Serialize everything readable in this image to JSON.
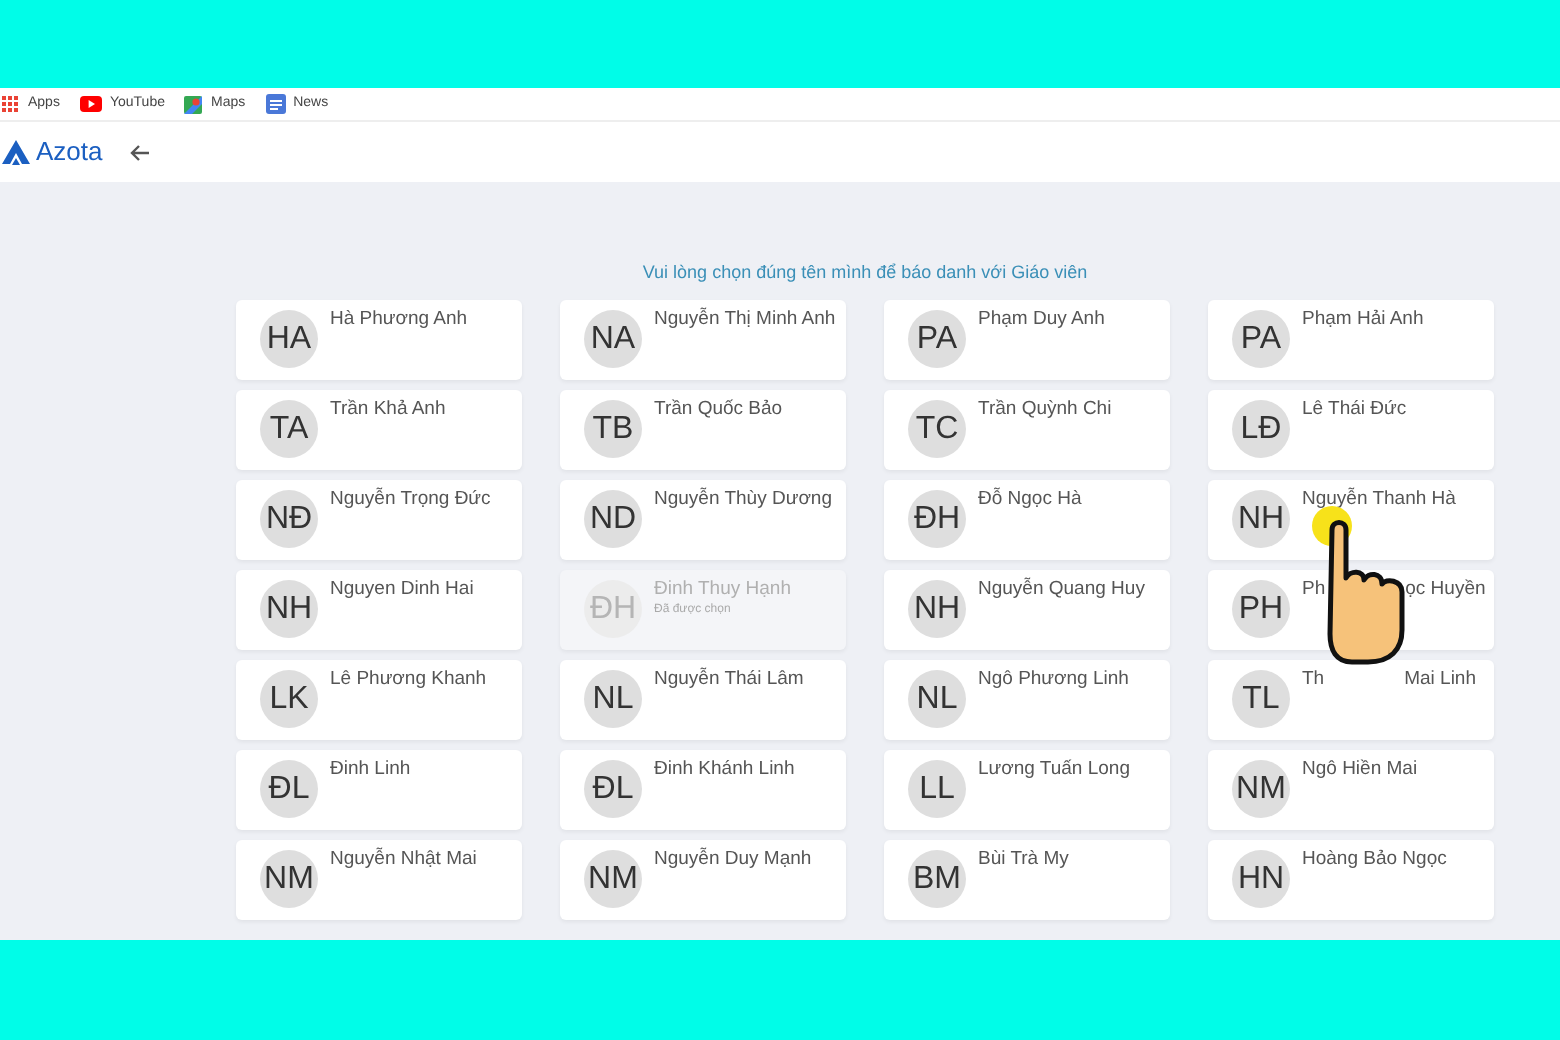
{
  "bookmarks": [
    {
      "kind": "apps",
      "label": "Apps"
    },
    {
      "kind": "youtube",
      "label": "YouTube"
    },
    {
      "kind": "maps",
      "label": "Maps"
    },
    {
      "kind": "news",
      "label": "News"
    }
  ],
  "brand": "Azota",
  "prompt": "Vui lòng chọn đúng tên mình để báo danh với Giáo viên",
  "students": [
    {
      "initials": "HA",
      "name": "Hà Phương Anh",
      "taken": false
    },
    {
      "initials": "NA",
      "name": "Nguyễn Thị Minh Anh",
      "taken": false
    },
    {
      "initials": "PA",
      "name": "Phạm Duy Anh",
      "taken": false
    },
    {
      "initials": "PA",
      "name": "Phạm Hải Anh",
      "taken": false
    },
    {
      "initials": "TA",
      "name": "Trần Khả Anh",
      "taken": false
    },
    {
      "initials": "TB",
      "name": "Trần Quốc Bảo",
      "taken": false
    },
    {
      "initials": "TC",
      "name": "Trần Quỳnh Chi",
      "taken": false
    },
    {
      "initials": "LĐ",
      "name": "Lê Thái Đức",
      "taken": false
    },
    {
      "initials": "NĐ",
      "name": "Nguyễn Trọng Đức",
      "taken": false
    },
    {
      "initials": "ND",
      "name": "Nguyễn Thùy Dương",
      "taken": false
    },
    {
      "initials": "ĐH",
      "name": "Đỗ Ngọc Hà",
      "taken": false
    },
    {
      "initials": "NH",
      "name": "Nguyễn Thanh Hà",
      "taken": false
    },
    {
      "initials": "NH",
      "name": "Nguyen Dinh Hai",
      "taken": false
    },
    {
      "initials": "ĐH",
      "name": "Đinh Thuy Hạnh",
      "taken": true,
      "note": "Đã được chọn"
    },
    {
      "initials": "NH",
      "name": "Nguyễn Quang Huy",
      "taken": false
    },
    {
      "initials": "PH",
      "name_parts": [
        "Ph",
        "ọc Huyền"
      ],
      "taken": false
    },
    {
      "initials": "LK",
      "name": "Lê Phương Khanh",
      "taken": false
    },
    {
      "initials": "NL",
      "name": "Nguyễn Thái Lâm",
      "taken": false
    },
    {
      "initials": "NL",
      "name": "Ngô Phương Linh",
      "taken": false
    },
    {
      "initials": "TL",
      "name_parts": [
        "Th",
        "Mai Linh"
      ],
      "taken": false
    },
    {
      "initials": "ĐL",
      "name": "Đinh Linh",
      "taken": false
    },
    {
      "initials": "ĐL",
      "name": "Đinh Khánh Linh",
      "taken": false
    },
    {
      "initials": "LL",
      "name": "Lương Tuấn Long",
      "taken": false
    },
    {
      "initials": "NM",
      "name": "Ngô Hiền Mai",
      "taken": false
    },
    {
      "initials": "NM",
      "name": "Nguyễn Nhật Mai",
      "taken": false
    },
    {
      "initials": "NM",
      "name": "Nguyễn Duy Mạnh",
      "taken": false
    },
    {
      "initials": "BM",
      "name": "Bùi Trà My",
      "taken": false
    },
    {
      "initials": "HN",
      "name": "Hoàng Bảo Ngọc",
      "taken": false
    }
  ]
}
